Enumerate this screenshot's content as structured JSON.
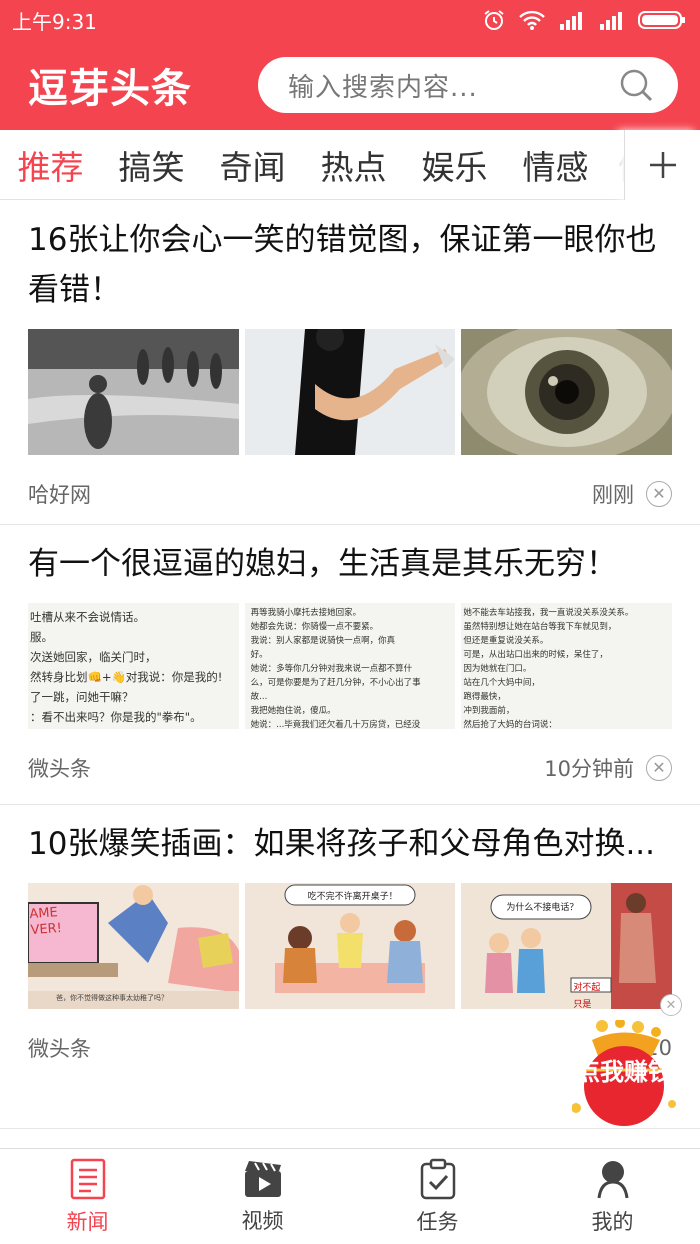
{
  "status_bar": {
    "time": "上午9:31"
  },
  "header": {
    "logo": "逗芽头条",
    "search_placeholder": "输入搜索内容..."
  },
  "tabs": {
    "items": [
      "推荐",
      "搞笑",
      "奇闻",
      "热点",
      "娱乐",
      "情感"
    ],
    "partial": "健",
    "active_index": 0
  },
  "articles": [
    {
      "title": "16张让你会心一笑的错觉图，保证第一眼你也看错！",
      "source": "哈好网",
      "time": "刚刚"
    },
    {
      "title": "有一个很逗逼的媳妇，生活真是其乐无穷！",
      "source": "微头条",
      "time": "10分钟前",
      "image_text": [
        "吐槽从来不会说情话。\n服。\n次送她回家，临关门时，\n然转身比划👊+👋对我说：你是我的!\n了一跳，问她干嘛？\n：看不出来吗？你是我的\"拳布\"。",
        "再等我骑小摩托去接她回家。\n她都会先说：你骑慢一点不要紧。\n我说：别人家都是说骑快一点啊，你真\n好。\n她说：多等你几分钟对我来说一点都不算什\n么，可是你要是为了赶几分钟，不小心出了事\n故...\n我把她抱住说，傻瓜。\n她说：...毕竟我们还欠着几十万房贷，已经没",
        "她不能去车站接我，我一直说没关系没关系。\n虽然特别想让她在站台等我下车就见到，\n但还是重复说没关系。\n可是，从出站口出来的时候，呆住了，\n因为她就在门口。\n站在几个大妈中间，\n跑得最快，\n冲到我面前，\n然后抢了大妈的台词说："
      ]
    },
    {
      "title": "10张爆笑插画：如果将孩子和父母角色对换...",
      "source": "微头条",
      "time": "20",
      "image_text": [
        "AME VER!",
        "吃不完不许离开桌子！",
        "为什么不接电话？",
        "爸，你不觉得做这种事太幼稚了吗？",
        "对不起",
        "只是"
      ]
    }
  ],
  "floating_button": {
    "label": "点我赚钱"
  },
  "bottom_nav": [
    {
      "label": "新闻",
      "icon": "news-icon",
      "active": true
    },
    {
      "label": "视频",
      "icon": "video-icon",
      "active": false
    },
    {
      "label": "任务",
      "icon": "task-icon",
      "active": false
    },
    {
      "label": "我的",
      "icon": "profile-icon",
      "active": false
    }
  ],
  "colors": {
    "brand": "#f3444f",
    "text": "#222222",
    "muted": "#666666"
  }
}
